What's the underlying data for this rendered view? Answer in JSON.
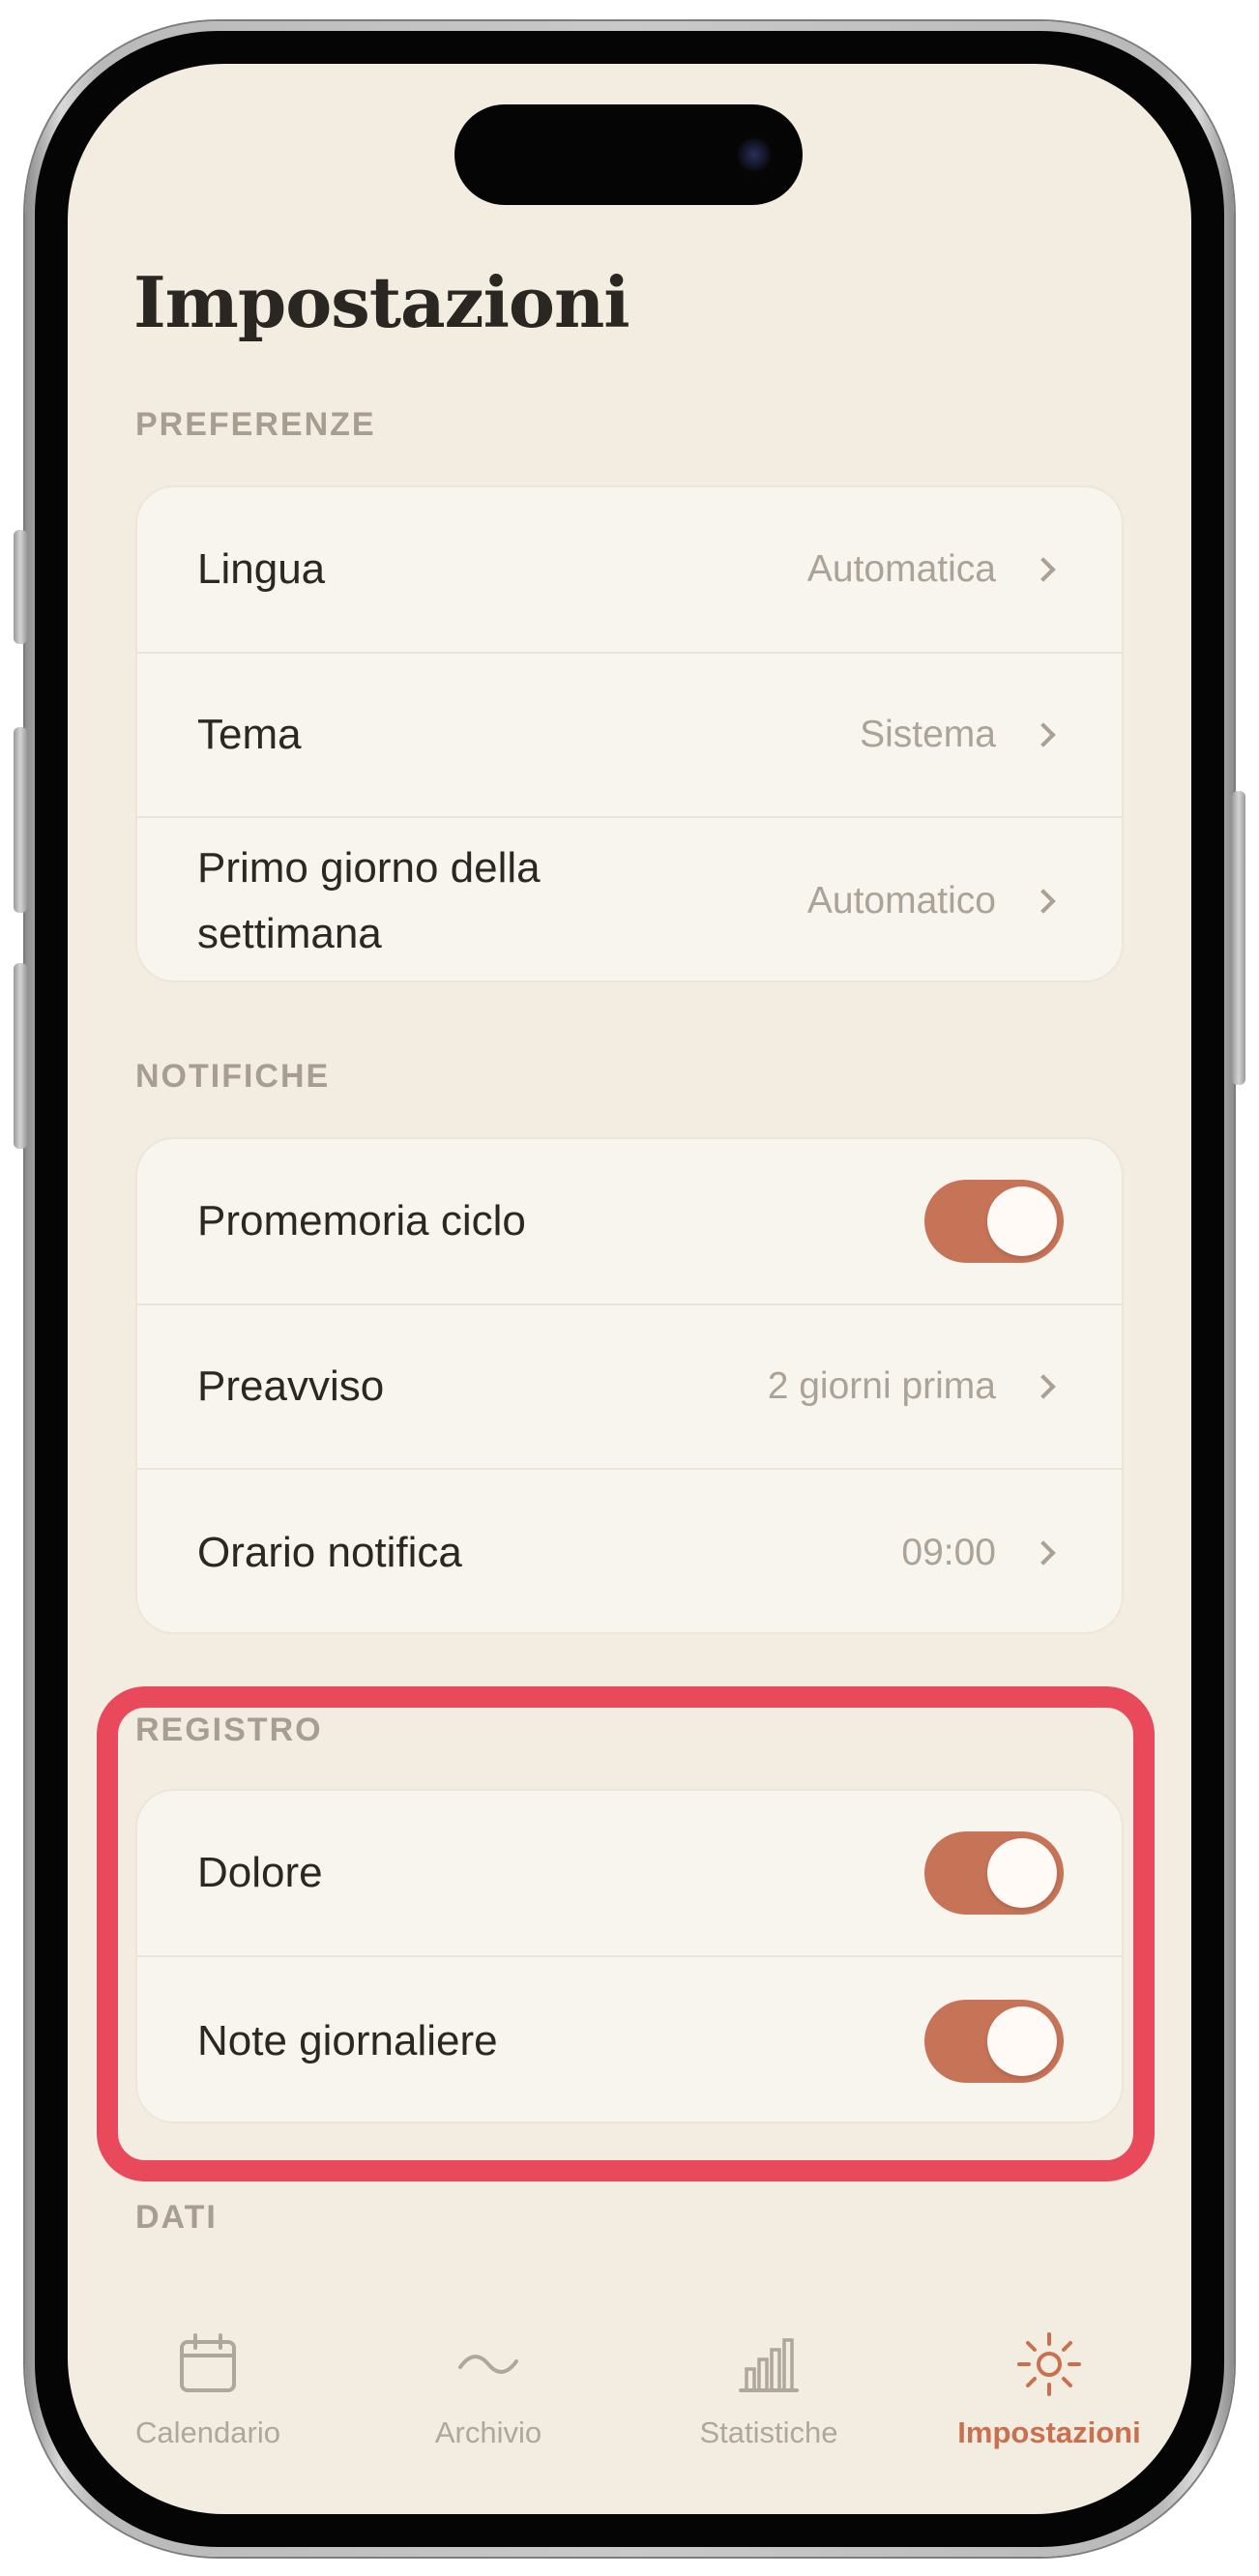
{
  "screen": {
    "title": "Impostazioni"
  },
  "sections": {
    "preferenze": {
      "label": "PREFERENZE",
      "rows": [
        {
          "label": "Lingua",
          "value": "Automatica"
        },
        {
          "label": "Tema",
          "value": "Sistema"
        },
        {
          "label": "Primo giorno della settimana",
          "value": "Automatico"
        }
      ]
    },
    "notifiche": {
      "label": "NOTIFICHE",
      "rows": [
        {
          "label": "Promemoria ciclo",
          "toggle": true
        },
        {
          "label": "Preavviso",
          "value": "2 giorni prima"
        },
        {
          "label": "Orario notifica",
          "value": "09:00"
        }
      ]
    },
    "registro": {
      "label": "REGISTRO",
      "rows": [
        {
          "label": "Dolore",
          "toggle": true
        },
        {
          "label": "Note giornaliere",
          "toggle": true
        }
      ]
    },
    "dati": {
      "label": "DATI"
    }
  },
  "tabbar": {
    "items": [
      {
        "label": "Calendario",
        "icon": "calendar-icon",
        "active": false
      },
      {
        "label": "Archivio",
        "icon": "wave-icon",
        "active": false
      },
      {
        "label": "Statistiche",
        "icon": "bar-chart-icon",
        "active": false
      },
      {
        "label": "Impostazioni",
        "icon": "sun-icon",
        "active": true
      }
    ]
  },
  "colors": {
    "background": "#f3ece1",
    "card": "#f8f4ee",
    "accent": "#c77358",
    "highlight": "#e84a5c",
    "muted_text": "#aca398"
  }
}
